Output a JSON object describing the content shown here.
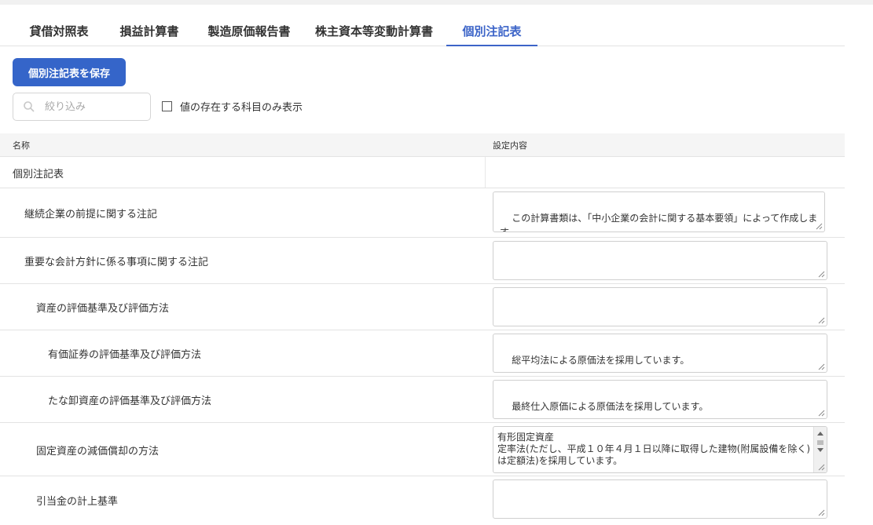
{
  "tabs": [
    {
      "label": "貸借対照表",
      "active": false
    },
    {
      "label": "損益計算書",
      "active": false
    },
    {
      "label": "製造原価報告書",
      "active": false
    },
    {
      "label": "株主資本等変動計算書",
      "active": false
    },
    {
      "label": "個別注記表",
      "active": true
    }
  ],
  "toolbar": {
    "save_label": "個別注記表を保存",
    "filter_placeholder": "絞り込み",
    "filter_value": "",
    "only_values_label": "値の存在する科目のみ表示",
    "only_values_checked": false
  },
  "table": {
    "col_name": "名称",
    "col_setting": "設定内容",
    "rows": [
      {
        "name": "個別注記表",
        "value": ""
      },
      {
        "name": "継続企業の前提に関する注記",
        "value": "この計算書類は、「中小企業の会計に関する基本要領」によって作成します。"
      },
      {
        "name": "重要な会計方針に係る事項に関する注記",
        "value": ""
      },
      {
        "name": "資産の評価基準及び評価方法",
        "value": ""
      },
      {
        "name": "有価証券の評価基準及び評価方法",
        "value": "総平均法による原価法を採用しています。"
      },
      {
        "name": "たな卸資産の評価基準及び評価方法",
        "value": "最終仕入原価による原価法を採用しています。"
      },
      {
        "name": "固定資産の減価償却の方法",
        "value": "有形固定資産\n定率法(ただし、平成１０年４月１日以降に取得した建物(附属設備を除く)は定額法)を採用しています。"
      },
      {
        "name": "引当金の計上基準",
        "value": ""
      }
    ]
  },
  "colors": {
    "accent": "#3565c9",
    "active_tab": "#3c64c8"
  }
}
